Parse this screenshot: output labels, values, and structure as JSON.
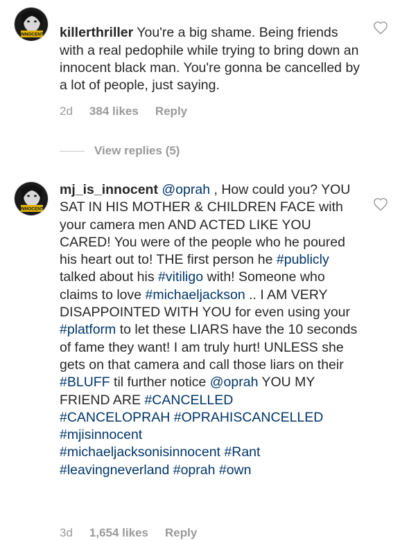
{
  "comments": [
    {
      "username": "killerthriller",
      "avatar_badge": "INNOCENT",
      "text": "You're a big shame. Being friends with a real pedophile while trying to bring down an innocent black man. You're gonna be cancelled by a lot of people, just saying.",
      "age": "2d",
      "likes": "384 likes",
      "reply": "Reply",
      "view_replies": "View replies (5)"
    },
    {
      "username": "mj_is_innocent",
      "avatar_badge": "INNOCENT",
      "age": "3d",
      "likes": "1,654 likes",
      "reply": "Reply",
      "parts": [
        {
          "t": "mention",
          "v": "@oprah"
        },
        {
          "t": "text",
          "v": " , How could you? YOU SAT IN HIS MOTHER & CHILDREN FACE with your camera men AND ACTED LIKE YOU CARED! You were of the people who he poured his heart out to! THE first person he "
        },
        {
          "t": "hashtag",
          "v": "#publicly"
        },
        {
          "t": "text",
          "v": " talked about his "
        },
        {
          "t": "hashtag",
          "v": "#vitiligo"
        },
        {
          "t": "text",
          "v": " with! Someone who claims to love "
        },
        {
          "t": "hashtag",
          "v": "#michaeljackson"
        },
        {
          "t": "text",
          "v": " .. I AM VERY DISAPPOINTED WITH YOU for even using your "
        },
        {
          "t": "hashtag",
          "v": "#platform"
        },
        {
          "t": "text",
          "v": " to let these LIARS have the 10 seconds of fame they want!  I am truly hurt! UNLESS she gets on that camera and call those liars on their "
        },
        {
          "t": "hashtag",
          "v": "#BLUFF"
        },
        {
          "t": "text",
          "v": " til further notice "
        },
        {
          "t": "mention",
          "v": "@oprah"
        },
        {
          "t": "text",
          "v": " YOU MY FRIEND ARE "
        },
        {
          "t": "hashtag",
          "v": "#CANCELLED"
        },
        {
          "t": "text",
          "v": "\n"
        },
        {
          "t": "hashtag",
          "v": "#CANCELOPRAH"
        },
        {
          "t": "text",
          "v": " "
        },
        {
          "t": "hashtag",
          "v": "#OPRAHISCANCELLED"
        },
        {
          "t": "text",
          "v": "\n"
        },
        {
          "t": "hashtag",
          "v": "#mjisinnocent"
        },
        {
          "t": "text",
          "v": "\n"
        },
        {
          "t": "hashtag",
          "v": "#michaeljacksonisinnocent"
        },
        {
          "t": "text",
          "v": "  "
        },
        {
          "t": "hashtag",
          "v": "#Rant"
        },
        {
          "t": "text",
          "v": "\n"
        },
        {
          "t": "hashtag",
          "v": "#leavingneverland"
        },
        {
          "t": "text",
          "v": " "
        },
        {
          "t": "hashtag",
          "v": "#oprah"
        },
        {
          "t": "text",
          "v": " "
        },
        {
          "t": "hashtag",
          "v": "#own"
        }
      ]
    }
  ],
  "colors": {
    "text": "#262626",
    "link": "#003569",
    "meta": "#999999"
  },
  "icons": {
    "like": "heart-outline-icon"
  }
}
